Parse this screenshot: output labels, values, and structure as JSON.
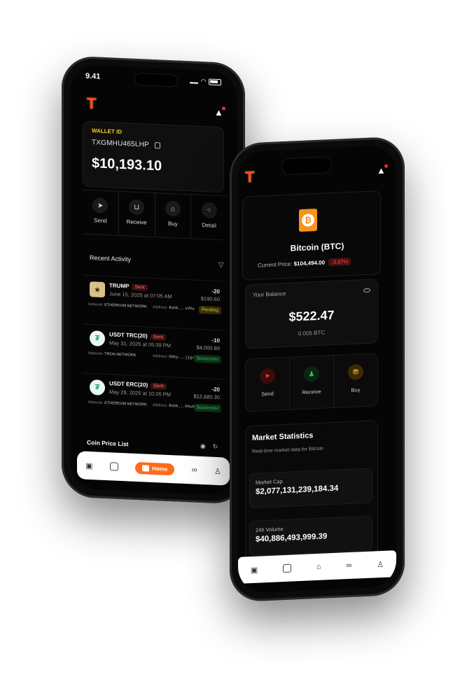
{
  "phone1": {
    "status_time": "9.41",
    "wallet": {
      "label": "WALLET ID",
      "id": "TXGMHU465LHP",
      "balance": "$10,193.10"
    },
    "actions": [
      {
        "label": "Send",
        "icon": "send-icon"
      },
      {
        "label": "Receive",
        "icon": "receive-icon"
      },
      {
        "label": "Buy",
        "icon": "buy-icon"
      },
      {
        "label": "Detail",
        "icon": "detail-icon"
      }
    ],
    "recent_activity": {
      "title": "Recent Activity",
      "transactions": [
        {
          "name": "TRUMP",
          "status_tag": "Sent",
          "date": "June 15, 2025 at 07:05 AM",
          "amount": "-20",
          "usd": "$190.60",
          "network_label": "Network:",
          "network": "ETHEREUM NETWORK",
          "address_label": "Address:",
          "address": "0xhk...xVVu",
          "badge": "Pending"
        },
        {
          "name": "USDT TRC(20)",
          "status_tag": "Sent",
          "date": "May 31, 2025 at 05:39 PM",
          "amount": "-10",
          "usd": "$4,000.89",
          "network_label": "Network:",
          "network": "TRON NETWORK",
          "address_label": "Address:",
          "address": "Ghky...jjgr",
          "badge": "Successful"
        },
        {
          "name": "USDT ERC(20)",
          "status_tag": "Sent",
          "date": "May 29, 2025 at 10:26 PM",
          "amount": "-20",
          "usd": "$12,680.30",
          "network_label": "Network:",
          "network": "ETHEREUM NETWORK",
          "address_label": "Address:",
          "address": "0xhk...hhuk",
          "badge": "Successful"
        }
      ]
    },
    "coin_price_list": "Coin Price List",
    "nav": {
      "home": "Home"
    }
  },
  "phone2": {
    "coin": {
      "title": "Bitcoin (BTC)",
      "price_label": "Current Price:",
      "price": "$104,494.00",
      "change": "-3.87%"
    },
    "your_balance": {
      "label": "Your Balance",
      "amount": "$522.47",
      "btc": "0.005 BTC"
    },
    "actions": [
      {
        "label": "Send"
      },
      {
        "label": "Receive"
      },
      {
        "label": "Buy"
      }
    ],
    "market": {
      "title": "Market Statistics",
      "subtitle": "Real-time market data for Bitcoin",
      "stats": [
        {
          "label": "Market Cap",
          "value": "$2,077,131,239,184.34"
        },
        {
          "label": "24h Volume",
          "value": "$40,886,493,999.39"
        }
      ]
    }
  },
  "colors": {
    "accent": "#ff6a1a",
    "wallet_label": "#f5d020",
    "success": "#38d066",
    "pending": "#f2d13b",
    "negative": "#ff4a4a"
  }
}
